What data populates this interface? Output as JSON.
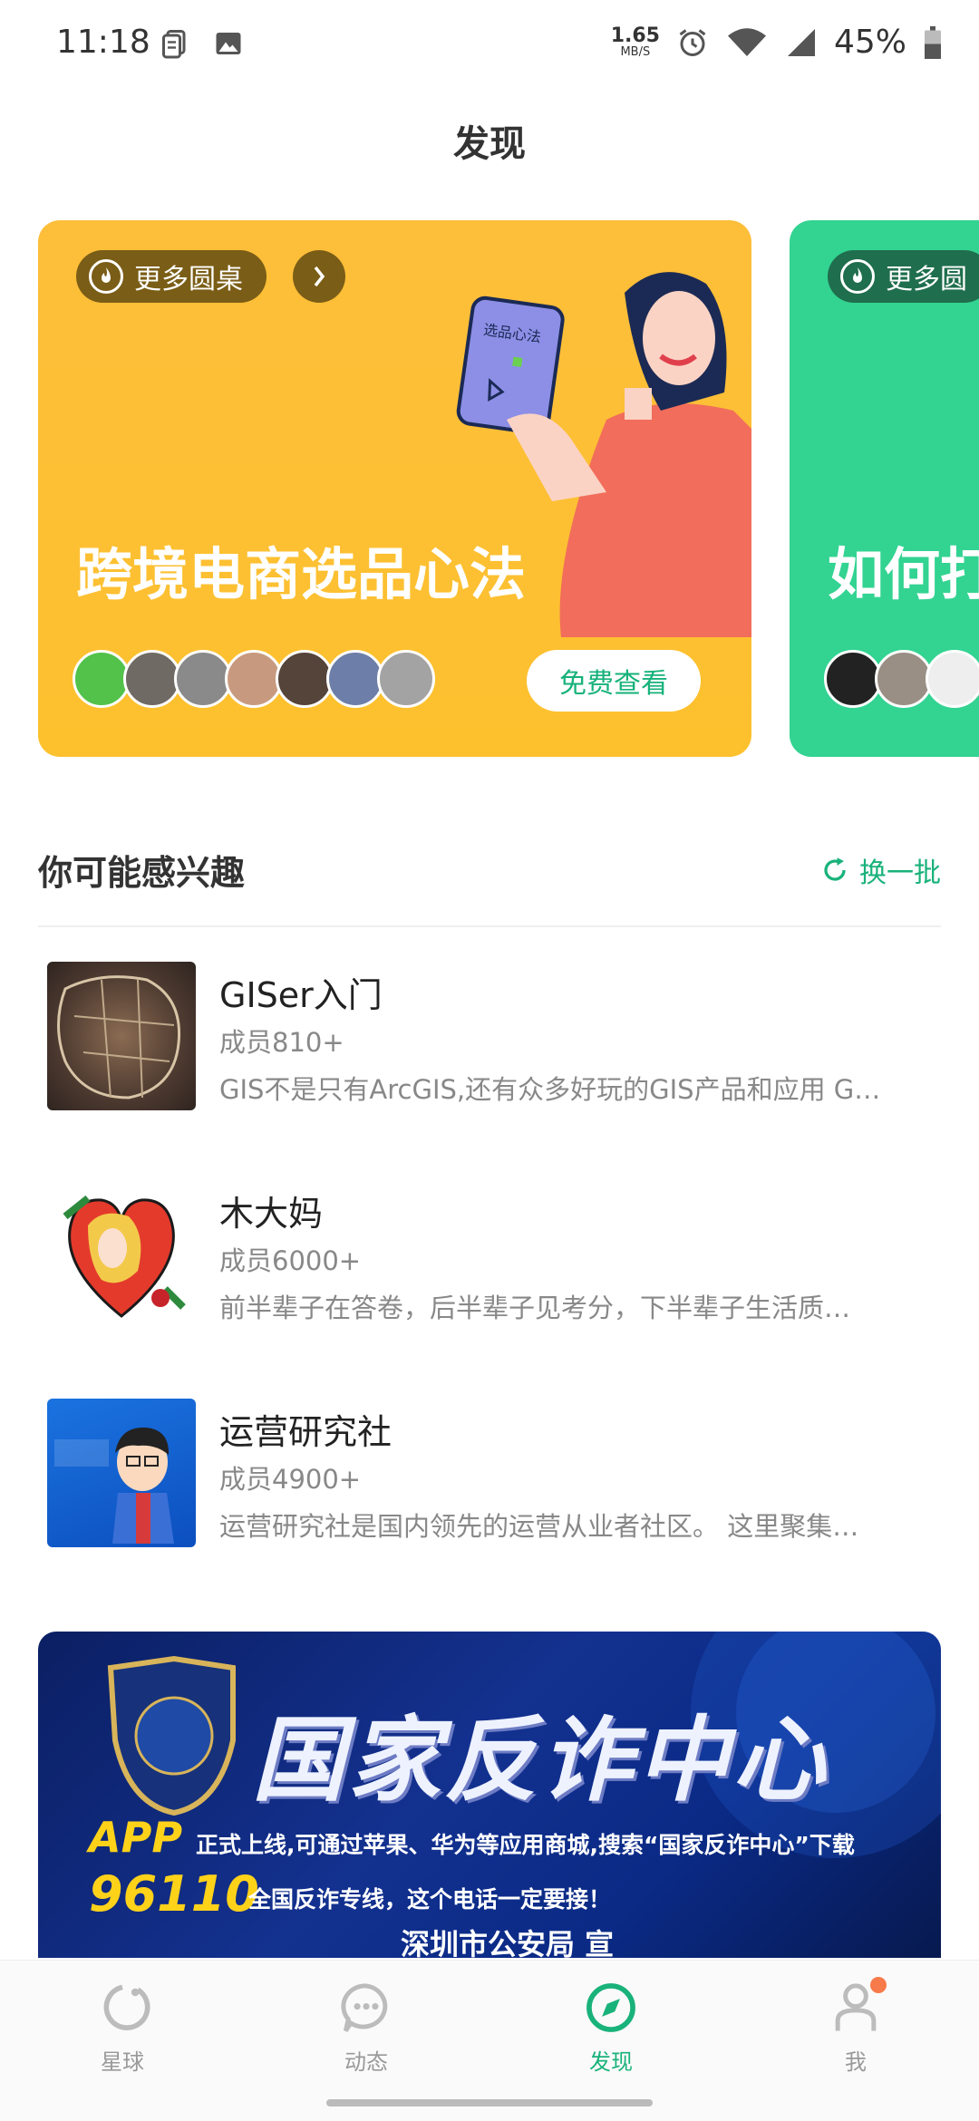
{
  "status_bar": {
    "time": "11:18",
    "net_speed_value": "1.65",
    "net_speed_unit": "MB/S",
    "battery": "45%",
    "icons": [
      "doc-icon",
      "image-icon",
      "alarm-icon",
      "wifi-icon",
      "signal-icon",
      "battery-icon"
    ]
  },
  "header": {
    "title": "发现"
  },
  "carousel": {
    "cards": [
      {
        "more_label": "更多圆桌",
        "title": "跨境电商选品心法",
        "cta": "免费查看",
        "card_text": "选品心法",
        "color": "#fdbe3a"
      },
      {
        "more_label": "更多圆",
        "title": "如何打",
        "color": "#33d392"
      }
    ]
  },
  "section": {
    "title": "你可能感兴趣",
    "refresh_label": "换一批"
  },
  "groups": [
    {
      "name": "GISer入门",
      "members": "成员810+",
      "desc": "GIS不是只有ArcGIS,还有众多好玩的GIS产品和应用 G…"
    },
    {
      "name": "木大妈",
      "members": "成员6000+",
      "desc": "前半辈子在答卷，后半辈子见考分，下半辈子生活质…"
    },
    {
      "name": "运营研究社",
      "members": "成员4900+",
      "desc": "运营研究社是国内领先的运营从业者社区。 这里聚集…"
    }
  ],
  "banner": {
    "title": "国家反诈中心",
    "app_label": "APP",
    "app_text": "正式上线,可通过苹果、华为等应用商城,搜索“国家反诈中心”下载",
    "phone_label": "96110",
    "phone_text": "全国反诈专线，这个电话一定要接！",
    "bottom_text": "深圳市公安局  宣"
  },
  "bottom_nav": {
    "items": [
      {
        "label": "星球",
        "icon": "planet-icon"
      },
      {
        "label": "动态",
        "icon": "chat-icon"
      },
      {
        "label": "发现",
        "icon": "compass-icon",
        "active": true
      },
      {
        "label": "我",
        "icon": "person-icon",
        "badge": true
      }
    ],
    "active_color": "#19b27b"
  }
}
